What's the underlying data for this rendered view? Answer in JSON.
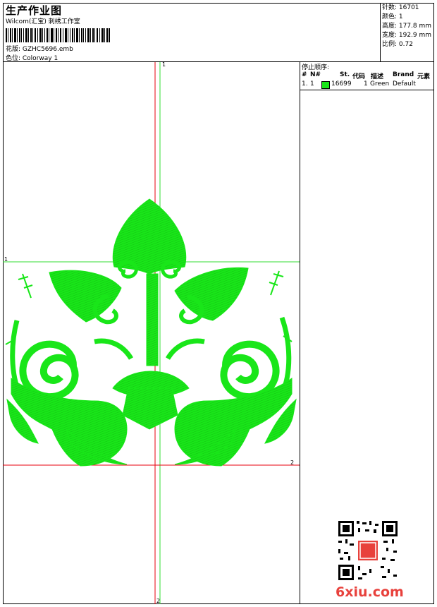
{
  "header": {
    "title": "生产作业图",
    "subtitle": "Wilcom(汇宝) 刺绣工作室",
    "design_label": "花版: GZHC5696.emb",
    "colorway_label": "色位: Colorway 1"
  },
  "stats": {
    "stitches": "针数: 16701",
    "colors": "颜色: 1",
    "height": "高度: 177.8 mm",
    "width": "宽度: 192.9 mm",
    "scale": "比例: 0.72"
  },
  "stop_sequence": {
    "title": "停止顺序:",
    "headers": [
      "#",
      "N#",
      "St.",
      "代码",
      "描述",
      "Brand",
      "元素"
    ],
    "rows": [
      {
        "index": "1.",
        "needle": "1",
        "stitches": "16699",
        "code": "1",
        "description": "Green",
        "brand": "Default",
        "color": "#19e619"
      }
    ]
  },
  "markers": {
    "top": "1",
    "left": "1",
    "right": "2",
    "bottom": "2"
  },
  "watermark": {
    "site": "6xiu.com",
    "seal": "刺绣"
  },
  "colors": {
    "thread": "#19e619",
    "guide_red": "#e8000d",
    "guide_green": "#33dd33"
  }
}
